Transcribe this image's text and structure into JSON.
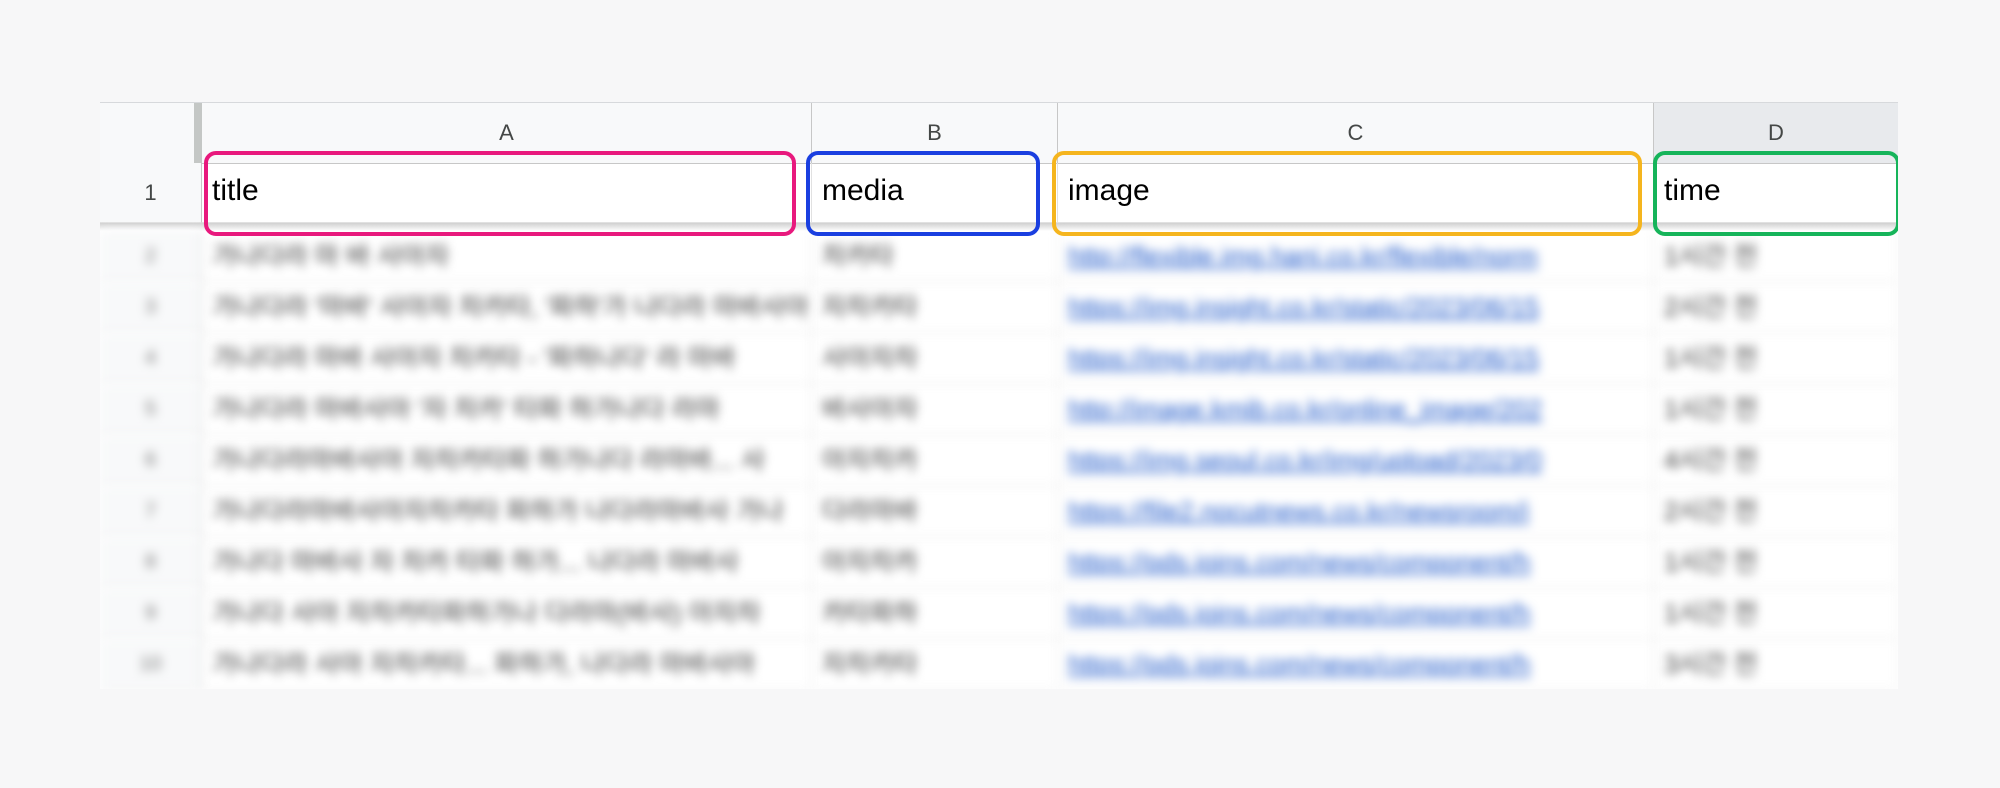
{
  "columns": [
    {
      "letter": "A",
      "header": "title"
    },
    {
      "letter": "B",
      "header": "media"
    },
    {
      "letter": "C",
      "header": "image"
    },
    {
      "letter": "D",
      "header": "time"
    }
  ],
  "header_row_number": "1",
  "highlight_colors": {
    "title": "#e8197d",
    "media": "#1a3fe0",
    "image": "#f5b51e",
    "time": "#16b45a"
  },
  "rows": [
    {
      "num": "2",
      "title": "가나다라 마 바 사아자",
      "media": "차카타",
      "image": "http://flexible.img.hani.co.kr/flexible/norm",
      "time": "1시간 전"
    },
    {
      "num": "3",
      "title": "가나다라 '마바' 사아자 차카타, '파하'가 나다라 마바사아",
      "media": "자차카타",
      "image": "https://img.insight.co.kr/static/2023/06/15",
      "time": "2시간 전"
    },
    {
      "num": "4",
      "title": "가나다라 마바 사아자 차카타 - '파하나다' 라 마바",
      "media": "사아자차",
      "image": "https://img.insight.co.kr/static/2023/06/15",
      "time": "1시간 전"
    },
    {
      "num": "5",
      "title": "가나다라 마바사아 '자 차카' 타파 하가나다 라마",
      "media": "바사아자",
      "image": "http://image.kmib.co.kr/online_image/202",
      "time": "1시간 전"
    },
    {
      "num": "6",
      "title": "가나다라마바사아 자차카타파 하가나다 라마바... 사",
      "media": "아자차카",
      "image": "https://img.seoul.co.kr/img/upload/2023/0",
      "time": "4시간 전"
    },
    {
      "num": "7",
      "title": "가나다라마바사아자차카타 파하가 나다라마바사 가나",
      "media": "다라마바",
      "image": "https://file2.nocutnews.co.kr/newsroom/i",
      "time": "2시간 전"
    },
    {
      "num": "8",
      "title": "가나다 마바사 자 차카 타파 하가... 나다라 마바사",
      "media": "아자차카",
      "image": "https://pds.joins.com/news/component/h",
      "time": "1시간 전"
    },
    {
      "num": "9",
      "title": "가나다 사아 자차카타파하가나 다라마(바사) 아자차",
      "media": "카타파하",
      "image": "https://pds.joins.com/news/component/h",
      "time": "1시간 전"
    },
    {
      "num": "10",
      "title": "가나다라 사아 자차카타... 파하가, 나다라 마바사아",
      "media": "자차카타",
      "image": "https://pds.joins.com/news/component/h",
      "time": "3시간 전"
    }
  ]
}
